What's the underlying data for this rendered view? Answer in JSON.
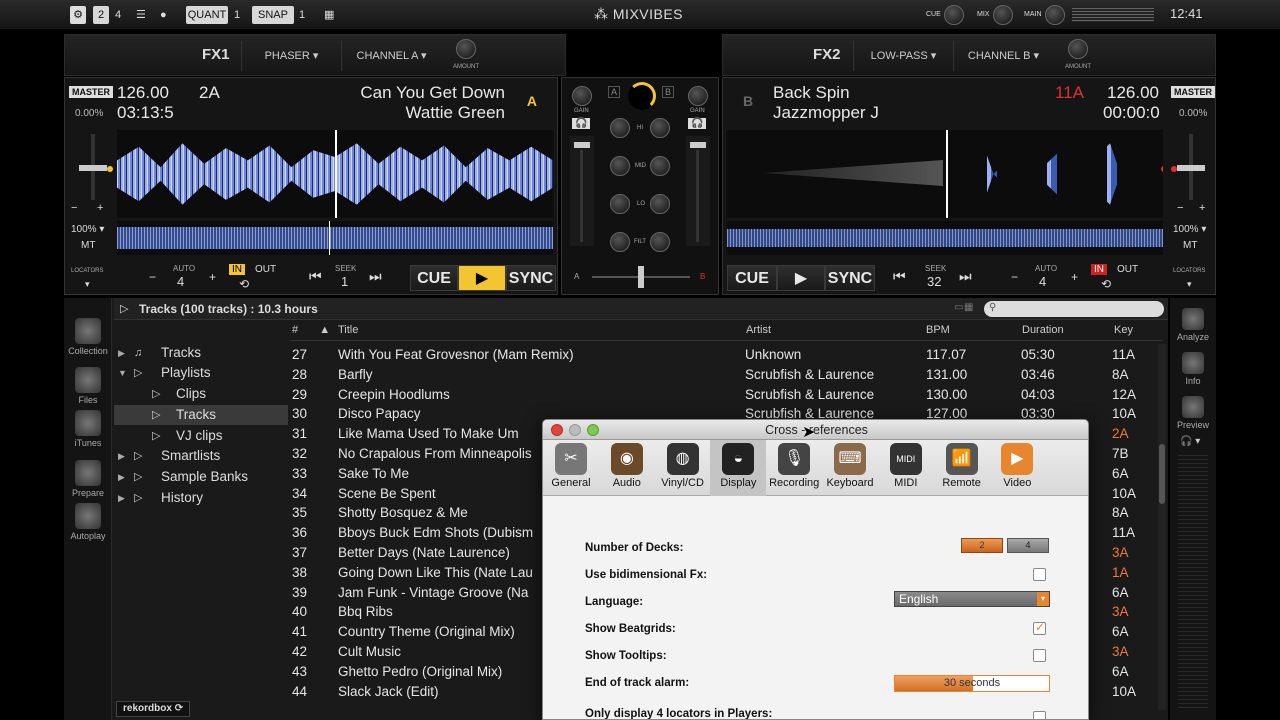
{
  "topbar": {
    "deck2": "2",
    "deck4": "4",
    "quant_label": "QUANT",
    "quant_val": "1",
    "snap_label": "SNAP",
    "snap_val": "1",
    "logo": "MIXVIBES",
    "cue_lbl": "CUE",
    "mix_lbl": "MIX",
    "main_lbl": "MAIN",
    "clock": "12:41"
  },
  "fx1": {
    "label": "FX1",
    "effect": "PHASER",
    "channel": "CHANNEL A",
    "amount": "AMOUNT"
  },
  "fx2": {
    "label": "FX2",
    "effect": "LOW-PASS",
    "channel": "CHANNEL B",
    "amount": "AMOUNT"
  },
  "deckA": {
    "master": "MASTER",
    "pitch": "0.00%",
    "bpm": "126.00",
    "time": "03:13:5",
    "key": "2A",
    "title": "Can You Get Down",
    "artist": "Wattie Green",
    "letter": "A",
    "tempo_range": "100%",
    "mt": "MT",
    "locators": "LOCATORS",
    "auto_lbl": "AUTO",
    "auto_val": "4",
    "in": "IN",
    "out": "OUT",
    "seek_lbl": "SEEK",
    "seek_val": "1",
    "cue": "CUE",
    "sync": "SYNC"
  },
  "deckB": {
    "master": "MASTER",
    "pitch": "0.00%",
    "bpm": "126.00",
    "time": "00:00:0",
    "key": "11A",
    "title": "Back Spin",
    "artist": "Jazzmopper J",
    "letter": "B",
    "tempo_range": "100%",
    "mt": "MT",
    "locators": "LOCATORS",
    "auto_lbl": "AUTO",
    "auto_val": "4",
    "in": "IN",
    "out": "OUT",
    "seek_lbl": "SEEK",
    "seek_val": "32",
    "cue": "CUE",
    "sync": "SYNC"
  },
  "mixer": {
    "gain": "GAIN",
    "hi": "HI",
    "mid": "MID",
    "lo": "LO",
    "filt": "FILT",
    "a": "A",
    "b": "B",
    "chA": "A",
    "chB": "B"
  },
  "browser": {
    "header": "Tracks (100 tracks) : 10.3 hours",
    "columns": {
      "num": "#",
      "title": "Title",
      "artist": "Artist",
      "bpm": "BPM",
      "duration": "Duration",
      "key": "Key"
    },
    "tree": [
      {
        "label": "Tracks",
        "indent": 0
      },
      {
        "label": "Playlists",
        "indent": 0
      },
      {
        "label": "Clips",
        "indent": 1
      },
      {
        "label": "Tracks",
        "indent": 1
      },
      {
        "label": "VJ clips",
        "indent": 1
      },
      {
        "label": "Smartlists",
        "indent": 0
      },
      {
        "label": "Sample Banks",
        "indent": 0
      },
      {
        "label": "History",
        "indent": 0
      }
    ],
    "rows": [
      {
        "n": "27",
        "title": "With You Feat Grovesnor (Mam Remix)",
        "artist": "Unknown",
        "bpm": "117.07",
        "dur": "05:30",
        "key": "11A",
        "hot": false
      },
      {
        "n": "28",
        "title": "Barfly",
        "artist": "Scrubfish & Laurence",
        "bpm": "131.00",
        "dur": "03:46",
        "key": "8A",
        "hot": false
      },
      {
        "n": "29",
        "title": "Creepin Hoodlums",
        "artist": "Scrubfish & Laurence",
        "bpm": "130.00",
        "dur": "04:03",
        "key": "12A",
        "hot": false
      },
      {
        "n": "30",
        "title": "Disco Papacy",
        "artist": "Scrubfish & Laurence",
        "bpm": "127.00",
        "dur": "03:30",
        "key": "10A",
        "hot": false
      },
      {
        "n": "31",
        "title": "Like Mama Used To Make Um",
        "artist": "",
        "bpm": "",
        "dur": "",
        "key": "2A",
        "hot": true
      },
      {
        "n": "32",
        "title": "No Crapalous From Minneapolis",
        "artist": "",
        "bpm": "",
        "dur": "",
        "key": "7B",
        "hot": false
      },
      {
        "n": "33",
        "title": "Sake To Me",
        "artist": "",
        "bpm": "",
        "dur": "",
        "key": "6A",
        "hot": false
      },
      {
        "n": "34",
        "title": "Scene Be Spent",
        "artist": "",
        "bpm": "",
        "dur": "",
        "key": "10A",
        "hot": false
      },
      {
        "n": "35",
        "title": "Shotty Bosquez & Me",
        "artist": "",
        "bpm": "",
        "dur": "",
        "key": "8A",
        "hot": false
      },
      {
        "n": "36",
        "title": "Bboys Buck Edm Shots (Dubism",
        "artist": "",
        "bpm": "",
        "dur": "",
        "key": "11A",
        "hot": false
      },
      {
        "n": "37",
        "title": "Better Days (Nate Laurence)",
        "artist": "",
        "bpm": "",
        "dur": "",
        "key": "3A",
        "hot": true
      },
      {
        "n": "38",
        "title": "Going Down Like This (Nate Lau",
        "artist": "",
        "bpm": "",
        "dur": "",
        "key": "1A",
        "hot": true
      },
      {
        "n": "39",
        "title": "Jam Funk - Vintage Groove (Na",
        "artist": "",
        "bpm": "",
        "dur": "",
        "key": "6A",
        "hot": false
      },
      {
        "n": "40",
        "title": "Bbq Ribs",
        "artist": "",
        "bpm": "",
        "dur": "",
        "key": "3A",
        "hot": true
      },
      {
        "n": "41",
        "title": "Country Theme (Original Mix)",
        "artist": "",
        "bpm": "",
        "dur": "",
        "key": "6A",
        "hot": false
      },
      {
        "n": "42",
        "title": "Cult Music",
        "artist": "",
        "bpm": "",
        "dur": "",
        "key": "3A",
        "hot": true
      },
      {
        "n": "43",
        "title": "Ghetto Pedro (Original Mix)",
        "artist": "",
        "bpm": "",
        "dur": "",
        "key": "6A",
        "hot": false
      },
      {
        "n": "44",
        "title": "Slack Jack (Edit)",
        "artist": "",
        "bpm": "",
        "dur": "",
        "key": "10A",
        "hot": false
      }
    ],
    "rekordbox": "rekordbox"
  },
  "sidebar_left": [
    {
      "label": "Collection"
    },
    {
      "label": "Files"
    },
    {
      "label": "iTunes"
    },
    {
      "label": "Prepare"
    },
    {
      "label": "Autoplay"
    }
  ],
  "sidebar_right": [
    {
      "label": "Analyze"
    },
    {
      "label": "Info"
    },
    {
      "label": "Preview"
    }
  ],
  "dialog": {
    "title": "Cross - references",
    "tabs": [
      "General",
      "Audio",
      "Vinyl/CD",
      "Display",
      "Recording",
      "Keyboard",
      "MIDI",
      "Remote",
      "Video"
    ],
    "selected_tab": "Display",
    "settings": {
      "decks_label": "Number of Decks:",
      "decks_opt1": "2",
      "decks_opt2": "4",
      "bidim_label": "Use bidimensional Fx:",
      "bidim_checked": false,
      "language_label": "Language:",
      "language_value": "English",
      "beatgrids_label": "Show Beatgrids:",
      "beatgrids_checked": true,
      "tooltips_label": "Show Tooltips:",
      "tooltips_checked": false,
      "alarm_label": "End of track alarm:",
      "alarm_value": "30 seconds",
      "locators_label": "Only display 4 locators in Players:",
      "locators_checked": false
    }
  },
  "colors": {
    "accent": "#f2c531",
    "hot_key": "#f07a3a",
    "wave_blue": "#7a8fe0",
    "dialog_orange": "#e8852f"
  }
}
